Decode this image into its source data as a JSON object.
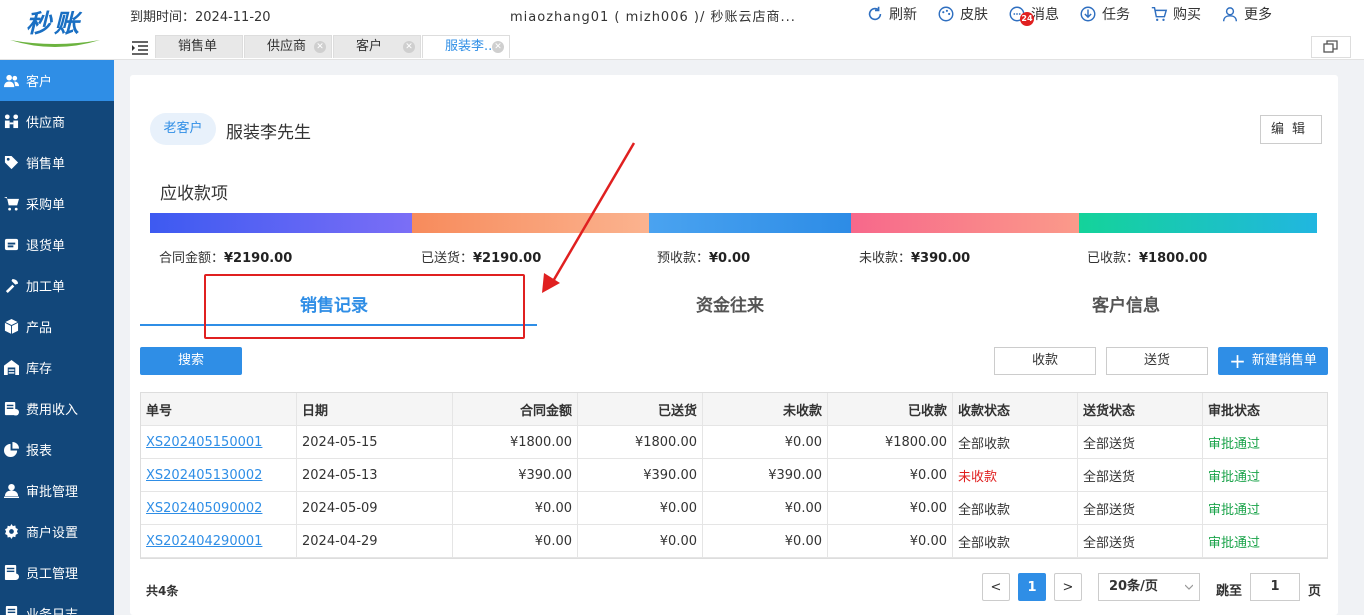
{
  "header": {
    "logo_text": "秒账",
    "expire_label": "到期时间：2024-11-20",
    "shop_info": "miaozhang01 ( mizh006 )/ 秒账云店商...",
    "tools": [
      {
        "label": "刷新",
        "icon": "refresh-icon"
      },
      {
        "label": "皮肤",
        "icon": "palette-icon"
      },
      {
        "label": "消息",
        "icon": "message-icon",
        "badge": "24"
      },
      {
        "label": "任务",
        "icon": "download-icon"
      },
      {
        "label": "购买",
        "icon": "cart-icon"
      },
      {
        "label": "更多",
        "icon": "user-icon"
      }
    ]
  },
  "tabs": [
    {
      "label": "销售单",
      "active": false
    },
    {
      "label": "供应商",
      "active": false
    },
    {
      "label": "客户",
      "active": false
    },
    {
      "label": "服装李...",
      "active": true
    }
  ],
  "sidebar": {
    "items": [
      {
        "label": "客户",
        "icon": "users-icon",
        "active": true
      },
      {
        "label": "供应商",
        "icon": "supplier-icon",
        "active": false
      },
      {
        "label": "销售单",
        "icon": "tag-icon",
        "active": false
      },
      {
        "label": "采购单",
        "icon": "cart-icon",
        "active": false
      },
      {
        "label": "退货单",
        "icon": "return-icon",
        "active": false
      },
      {
        "label": "加工单",
        "icon": "tool-icon",
        "active": false
      },
      {
        "label": "产品",
        "icon": "box-icon",
        "active": false
      },
      {
        "label": "库存",
        "icon": "warehouse-icon",
        "active": false
      },
      {
        "label": "费用收入",
        "icon": "money-icon",
        "active": false
      },
      {
        "label": "报表",
        "icon": "pie-icon",
        "active": false
      },
      {
        "label": "审批管理",
        "icon": "approve-icon",
        "active": false
      },
      {
        "label": "商户设置",
        "icon": "gear-icon",
        "active": false
      },
      {
        "label": "员工管理",
        "icon": "staff-icon",
        "active": false
      },
      {
        "label": "业务日志",
        "icon": "log-icon",
        "active": false
      }
    ]
  },
  "customer": {
    "tag": "老客户",
    "name": "服装李先生",
    "edit_label": "编辑"
  },
  "receivables": {
    "title": "应收款项",
    "segments": [
      {
        "label": "合同金额：",
        "value": "¥2190.00",
        "color_from": "#3d5af1",
        "color_to": "#7b6ef6"
      },
      {
        "label": "已送货：",
        "value": "¥2190.00",
        "color_from": "#f78b5c",
        "color_to": "#fbb38f"
      },
      {
        "label": "预收款：",
        "value": "¥0.00",
        "color_from": "#4aa3f0",
        "color_to": "#2d8ce6"
      },
      {
        "label": "未收款：",
        "value": "¥390.00",
        "color_from": "#f7688b",
        "color_to": "#fb9a8a"
      },
      {
        "label": "已收款：",
        "value": "¥1800.00",
        "color_from": "#14d39a",
        "color_to": "#21b6e0"
      }
    ]
  },
  "detail_tabs": [
    {
      "label": "销售记录",
      "active": true
    },
    {
      "label": "资金往来",
      "active": false
    },
    {
      "label": "客户信息",
      "active": false
    }
  ],
  "actions": {
    "search": "搜索",
    "receive": "收款",
    "deliver": "送货",
    "new_order": "新建销售单"
  },
  "table": {
    "columns": [
      "单号",
      "日期",
      "合同金额",
      "已送货",
      "未收款",
      "已收款",
      "收款状态",
      "送货状态",
      "审批状态"
    ],
    "rows": [
      [
        "XS202405150001",
        "2024-05-15",
        "¥1800.00",
        "¥1800.00",
        "¥0.00",
        "¥1800.00",
        "全部收款",
        "全部送货",
        "审批通过"
      ],
      [
        "XS202405130002",
        "2024-05-13",
        "¥390.00",
        "¥390.00",
        "¥390.00",
        "¥0.00",
        "未收款",
        "全部送货",
        "审批通过"
      ],
      [
        "XS202405090002",
        "2024-05-09",
        "¥0.00",
        "¥0.00",
        "¥0.00",
        "¥0.00",
        "全部收款",
        "全部送货",
        "审批通过"
      ],
      [
        "XS202404290001",
        "2024-04-29",
        "¥0.00",
        "¥0.00",
        "¥0.00",
        "¥0.00",
        "全部收款",
        "全部送货",
        "审批通过"
      ]
    ]
  },
  "pagination": {
    "total": "共4条",
    "prev": "<",
    "current": "1",
    "next": ">",
    "page_size": "20条/页",
    "jump_label": "跳至",
    "jump_value": "1",
    "page_unit": "页"
  },
  "colors": {
    "accent": "#2f8ee6",
    "sidebar": "#12477a",
    "annotation": "#e02020",
    "approved": "#1aa34a",
    "unpaid": "#e02020"
  }
}
